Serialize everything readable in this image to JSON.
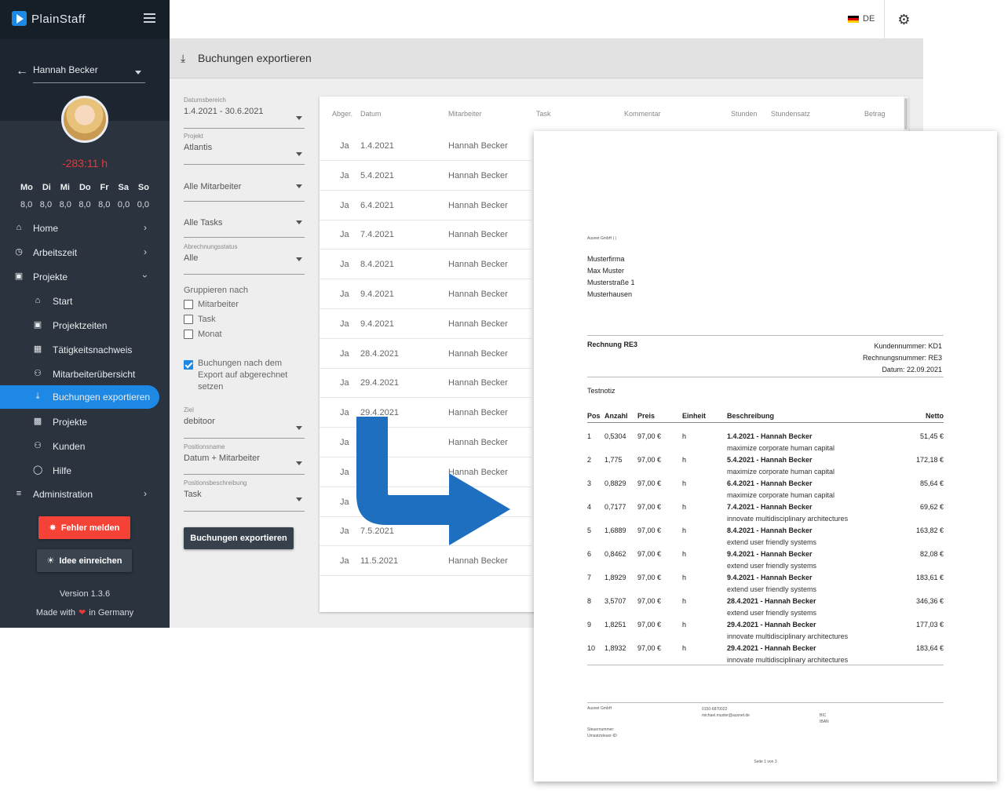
{
  "app": {
    "brand": "PlainStaff"
  },
  "sidebar": {
    "user_name": "Hannah Becker",
    "balance": "-283:11 h",
    "weekdays": [
      "Mo",
      "Di",
      "Mi",
      "Do",
      "Fr",
      "Sa",
      "So"
    ],
    "weekday_hours": [
      "8,0",
      "8,0",
      "8,0",
      "8,0",
      "8,0",
      "0,0",
      "0,0"
    ],
    "nav": {
      "home": "Home",
      "arbeitszeit": "Arbeitszeit",
      "projekte": "Projekte",
      "start": "Start",
      "projektzeiten": "Projektzeiten",
      "taetigkeitsnachweis": "Tätigkeitsnachweis",
      "mitarbeiteruebersicht": "Mitarbeiterübersicht",
      "buchungen_exportieren": "Buchungen exportieren",
      "projekte_sub": "Projekte",
      "kunden": "Kunden",
      "hilfe": "Hilfe",
      "administration": "Administration"
    },
    "report_button": "Fehler melden",
    "idea_button": "Idee einreichen",
    "version": "Version 1.3.6",
    "made_with_prefix": "Made with",
    "made_with_suffix": "in Germany"
  },
  "topbar": {
    "language": "DE"
  },
  "header": {
    "title": "Buchungen exportieren"
  },
  "filters": {
    "date_range_label": "Datumsbereich",
    "date_range_value": "1.4.2021 - 30.6.2021",
    "project_label": "Projekt",
    "project_value": "Atlantis",
    "employees_value": "Alle Mitarbeiter",
    "tasks_value": "Alle Tasks",
    "billing_status_label": "Abrechnungsstatus",
    "billing_status_value": "Alle",
    "group_by_label": "Gruppieren nach",
    "group_employee": "Mitarbeiter",
    "group_task": "Task",
    "group_month": "Monat",
    "mark_billed_label": "Buchungen nach dem Export auf abgerechnet setzen",
    "target_label": "Ziel",
    "target_value": "debitoor",
    "position_name_label": "Positionsname",
    "position_name_value": "Datum + Mitarbeiter",
    "position_desc_label": "Positionsbeschreibung",
    "position_desc_value": "Task",
    "export_button": "Buchungen exportieren"
  },
  "table": {
    "headers": [
      "Abger.",
      "Datum",
      "Mitarbeiter",
      "Task",
      "Kommentar",
      "Stunden",
      "Stundensatz",
      "Betrag"
    ],
    "rows": [
      {
        "billed": "Ja",
        "date": "1.4.2021",
        "employee": "Hannah Becker"
      },
      {
        "billed": "Ja",
        "date": "5.4.2021",
        "employee": "Hannah Becker"
      },
      {
        "billed": "Ja",
        "date": "6.4.2021",
        "employee": "Hannah Becker"
      },
      {
        "billed": "Ja",
        "date": "7.4.2021",
        "employee": "Hannah Becker"
      },
      {
        "billed": "Ja",
        "date": "8.4.2021",
        "employee": "Hannah Becker"
      },
      {
        "billed": "Ja",
        "date": "9.4.2021",
        "employee": "Hannah Becker"
      },
      {
        "billed": "Ja",
        "date": "9.4.2021",
        "employee": "Hannah Becker"
      },
      {
        "billed": "Ja",
        "date": "28.4.2021",
        "employee": "Hannah Becker"
      },
      {
        "billed": "Ja",
        "date": "29.4.2021",
        "employee": "Hannah Becker"
      },
      {
        "billed": "Ja",
        "date": "29.4.2021",
        "employee": "Hannah Becker"
      },
      {
        "billed": "Ja",
        "date": "",
        "employee": "Hannah Becker"
      },
      {
        "billed": "Ja",
        "date": "",
        "employee": "Hannah Becker"
      },
      {
        "billed": "Ja",
        "date": "",
        "employee": ""
      },
      {
        "billed": "Ja",
        "date": "7.5.2021",
        "employee": ""
      },
      {
        "billed": "Ja",
        "date": "11.5.2021",
        "employee": "Hannah Becker"
      }
    ]
  },
  "invoice": {
    "sender_line": "Ausnet GmbH | |",
    "recipient": [
      "Musterfirma",
      "Max Muster",
      "Musterstraße 1",
      "Musterhausen"
    ],
    "title": "Rechnung RE3",
    "customer_no": "Kundennummer: KD1",
    "invoice_no": "Rechnungsnummer: RE3",
    "date": "Datum: 22.09.2021",
    "note": "Testnotiz",
    "columns": [
      "Pos",
      "Anzahl",
      "Preis",
      "Einheit",
      "Beschreibung",
      "Netto"
    ],
    "items": [
      {
        "pos": "1",
        "qty": "0,5304",
        "price": "97,00 €",
        "unit": "h",
        "title": "1.4.2021 - Hannah Becker",
        "desc": "maximize corporate human capital",
        "net": "51,45 €"
      },
      {
        "pos": "2",
        "qty": "1,775",
        "price": "97,00 €",
        "unit": "h",
        "title": "5.4.2021 - Hannah Becker",
        "desc": "maximize corporate human capital",
        "net": "172,18 €"
      },
      {
        "pos": "3",
        "qty": "0,8829",
        "price": "97,00 €",
        "unit": "h",
        "title": "6.4.2021 - Hannah Becker",
        "desc": "maximize corporate human capital",
        "net": "85,64 €"
      },
      {
        "pos": "4",
        "qty": "0,7177",
        "price": "97,00 €",
        "unit": "h",
        "title": "7.4.2021 - Hannah Becker",
        "desc": "innovate multidisciplinary architectures",
        "net": "69,62 €"
      },
      {
        "pos": "5",
        "qty": "1,6889",
        "price": "97,00 €",
        "unit": "h",
        "title": "8.4.2021 - Hannah Becker",
        "desc": "extend user friendly systems",
        "net": "163,82 €"
      },
      {
        "pos": "6",
        "qty": "0,8462",
        "price": "97,00 €",
        "unit": "h",
        "title": "9.4.2021 - Hannah Becker",
        "desc": "extend user friendly systems",
        "net": "82,08 €"
      },
      {
        "pos": "7",
        "qty": "1,8929",
        "price": "97,00 €",
        "unit": "h",
        "title": "9.4.2021 - Hannah Becker",
        "desc": "extend user friendly systems",
        "net": "183,61 €"
      },
      {
        "pos": "8",
        "qty": "3,5707",
        "price": "97,00 €",
        "unit": "h",
        "title": "28.4.2021 - Hannah Becker",
        "desc": "extend user friendly systems",
        "net": "346,36 €"
      },
      {
        "pos": "9",
        "qty": "1,8251",
        "price": "97,00 €",
        "unit": "h",
        "title": "29.4.2021 - Hannah Becker",
        "desc": "innovate multidisciplinary architectures",
        "net": "177,03 €"
      },
      {
        "pos": "10",
        "qty": "1,8932",
        "price": "97,00 €",
        "unit": "h",
        "title": "29.4.2021 - Hannah Becker",
        "desc": "innovate multidisciplinary architectures",
        "net": "183,64 €"
      }
    ],
    "footer": {
      "company": "Ausnet GmbH",
      "tax_lines": [
        "Steuernummer:",
        "Umsatzsteuer-ID:"
      ],
      "contact": [
        "0150-6870022",
        "michael.muster@ausnet.de"
      ],
      "bank": [
        "BIC",
        "IBAN"
      ],
      "page": "Seite 1 von 3"
    }
  },
  "colors": {
    "accent": "#1e88e5",
    "danger": "#f44336",
    "sidebar": "#1c2530",
    "arrow": "#1e6fc0"
  }
}
